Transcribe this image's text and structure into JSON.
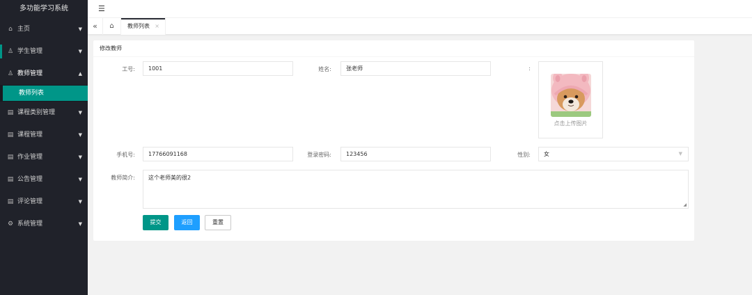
{
  "app": {
    "title": "多功能学习系统"
  },
  "sidebar": {
    "items": [
      {
        "label": "主页",
        "icon": "home-icon",
        "glyph": "⌂"
      },
      {
        "label": "学生管理",
        "icon": "user-icon",
        "glyph": "♙"
      },
      {
        "label": "教师管理",
        "icon": "user-icon",
        "glyph": "♙"
      },
      {
        "label": "课程类别管理",
        "icon": "list-icon",
        "glyph": "▤"
      },
      {
        "label": "课程管理",
        "icon": "list-icon",
        "glyph": "▤"
      },
      {
        "label": "作业管理",
        "icon": "list-icon",
        "glyph": "▤"
      },
      {
        "label": "公告管理",
        "icon": "list-icon",
        "glyph": "▤"
      },
      {
        "label": "评论管理",
        "icon": "list-icon",
        "glyph": "▤"
      },
      {
        "label": "系统管理",
        "icon": "gear-icon",
        "glyph": "⚙"
      }
    ],
    "sub_item": "教师列表"
  },
  "header": {
    "menu_glyph": "☰"
  },
  "tabs": {
    "collapse_glyph": "«",
    "home_glyph": "⌂",
    "active_tab": "教师列表",
    "close_glyph": "×"
  },
  "form": {
    "title": "修改教师",
    "labels": {
      "work_id": "工号:",
      "name": "姓名:",
      "photo": ":",
      "phone": "手机号:",
      "password": "登录密码:",
      "gender": "性别:",
      "intro": "教师简介:"
    },
    "values": {
      "work_id": "1001",
      "name": "张老师",
      "phone": "17766091168",
      "password": "123456",
      "gender": "女",
      "intro": "这个老师美的很2"
    },
    "upload_label": "点击上传图片",
    "buttons": {
      "submit": "提交",
      "back": "返回",
      "reset": "重置"
    }
  },
  "colors": {
    "sidebar_bg": "#20222a",
    "accent": "#009688",
    "blue": "#1e9fff"
  }
}
